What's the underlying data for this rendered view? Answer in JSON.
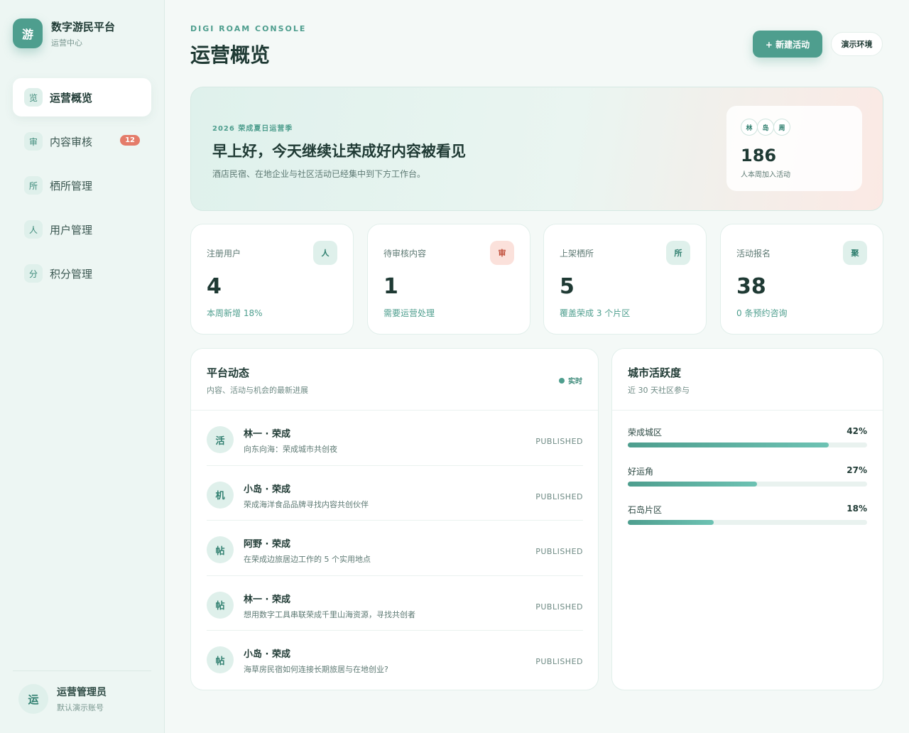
{
  "brand": {
    "logo": "游",
    "name": "数字游民平台",
    "subtitle": "运营中心"
  },
  "sidebar": {
    "items": [
      {
        "icon": "览",
        "label": "运营概览",
        "active": true
      },
      {
        "icon": "审",
        "label": "内容审核",
        "badge": "12"
      },
      {
        "icon": "所",
        "label": "栖所管理"
      },
      {
        "icon": "人",
        "label": "用户管理"
      },
      {
        "icon": "分",
        "label": "积分管理"
      }
    ],
    "user": {
      "avatar": "运",
      "name": "运营管理员",
      "subtitle": "默认演示账号"
    }
  },
  "header": {
    "eyebrow": "DIGI ROAM CONSOLE",
    "title": "运营概览",
    "primary_button": "+ 新建活动",
    "env_button": "演示环境"
  },
  "hero": {
    "season": "2026 荣成夏日运营季",
    "title": "早上好，今天继续让荣成好内容被看见",
    "desc": "酒店民宿、在地企业与社区活动已经集中到下方工作台。",
    "chips": [
      "林",
      "岛",
      "周"
    ],
    "count": "186",
    "count_label": "人本周加入活动"
  },
  "stats": [
    {
      "label": "注册用户",
      "icon": "人",
      "value": "4",
      "note": "本周新增 18%"
    },
    {
      "label": "待审核内容",
      "icon": "审",
      "value": "1",
      "note": "需要运营处理"
    },
    {
      "label": "上架栖所",
      "icon": "所",
      "value": "5",
      "note": "覆盖荣成 3 个片区"
    },
    {
      "label": "活动报名",
      "icon": "聚",
      "value": "38",
      "note": "0 条预约咨询"
    }
  ],
  "feed": {
    "title": "平台动态",
    "subtitle": "内容、活动与机会的最新进展",
    "live": "实时",
    "items": [
      {
        "icon": "活",
        "author": "林一 · 荣成",
        "desc": "向东向海：荣成城市共创夜",
        "status": "PUBLISHED"
      },
      {
        "icon": "机",
        "author": "小岛 · 荣成",
        "desc": "荣成海洋食品品牌寻找内容共创伙伴",
        "status": "PUBLISHED"
      },
      {
        "icon": "帖",
        "author": "阿野 · 荣成",
        "desc": "在荣成边旅居边工作的 5 个实用地点",
        "status": "PUBLISHED"
      },
      {
        "icon": "帖",
        "author": "林一 · 荣成",
        "desc": "想用数字工具串联荣成千里山海资源，寻找共创者",
        "status": "PUBLISHED"
      },
      {
        "icon": "帖",
        "author": "小岛 · 荣成",
        "desc": "海草房民宿如何连接长期旅居与在地创业?",
        "status": "PUBLISHED"
      }
    ]
  },
  "activity": {
    "title": "城市活跃度",
    "subtitle": "近 30 天社区参与",
    "rows": [
      {
        "label": "荣成城区",
        "pct": "42%",
        "value": 42
      },
      {
        "label": "好运角",
        "pct": "27%",
        "value": 27
      },
      {
        "label": "石岛片区",
        "pct": "18%",
        "value": 18
      }
    ],
    "scale_max": 50
  }
}
